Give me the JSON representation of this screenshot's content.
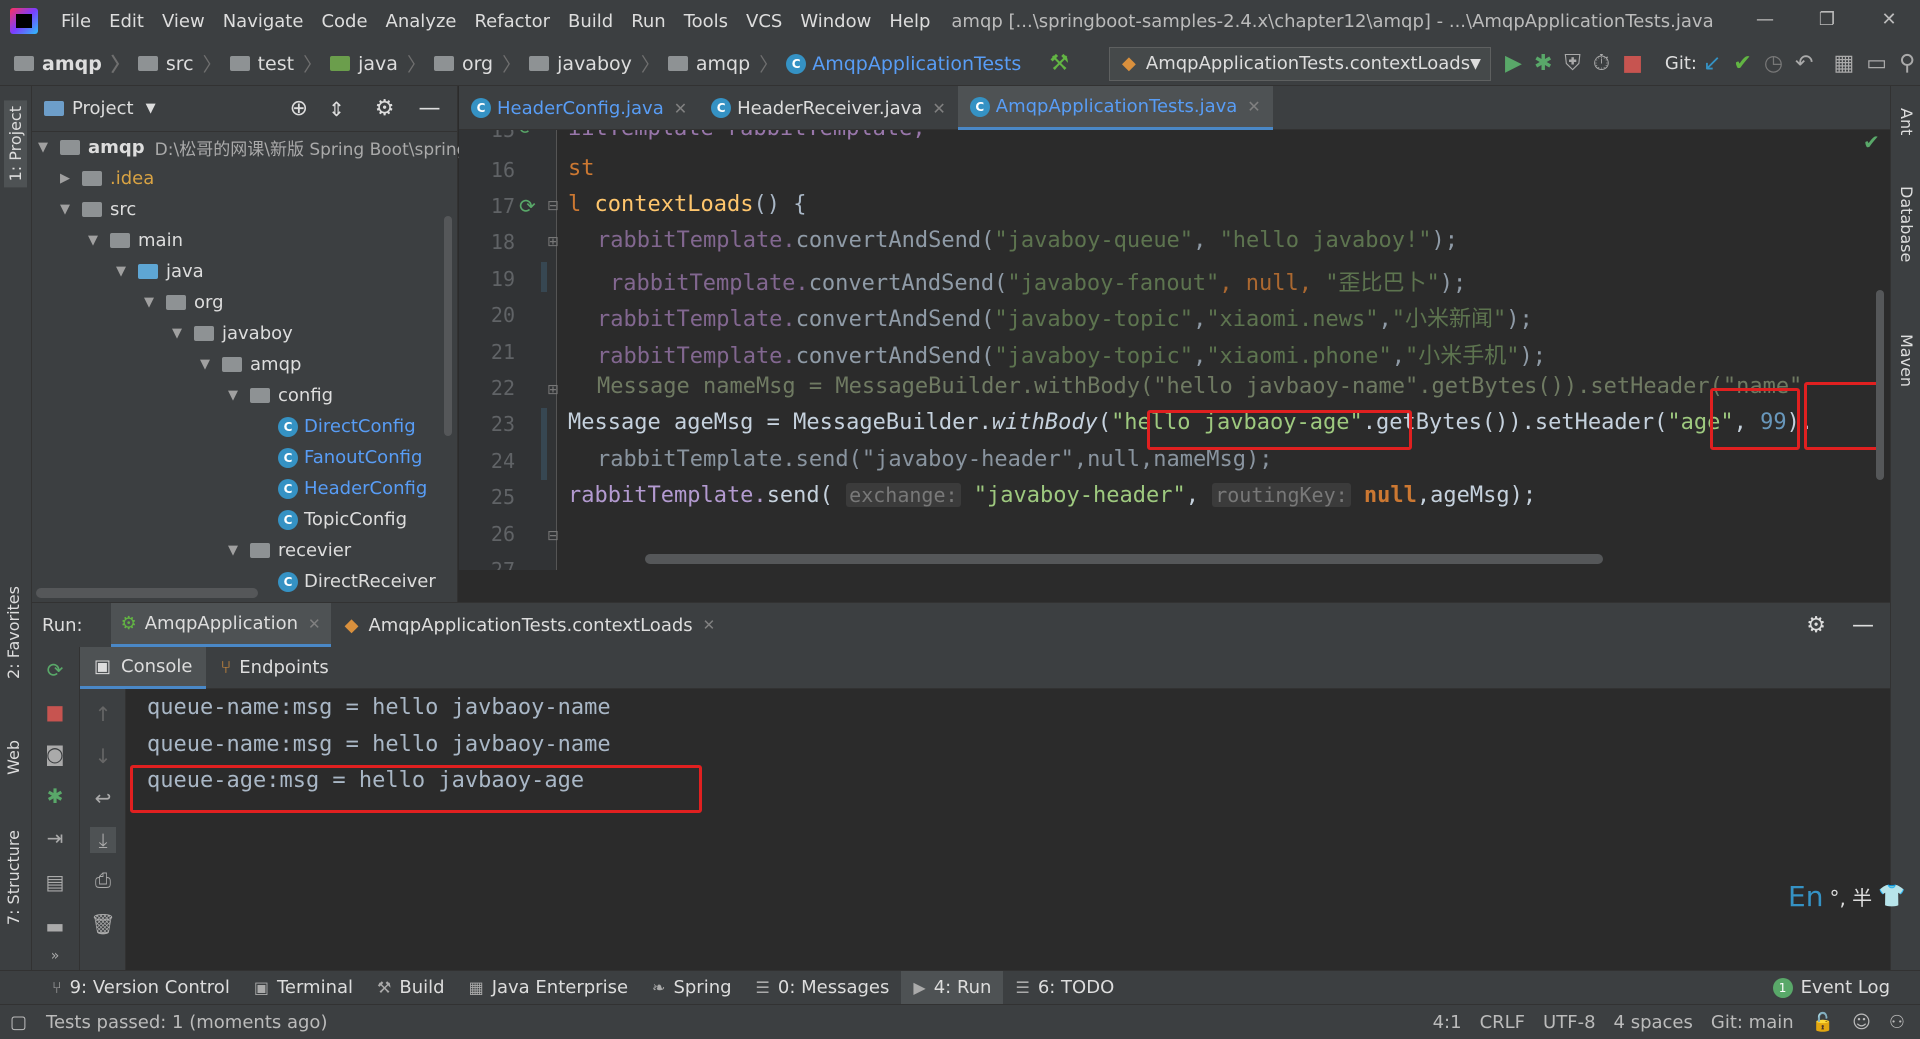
{
  "menu": [
    "File",
    "Edit",
    "View",
    "Navigate",
    "Code",
    "Analyze",
    "Refactor",
    "Build",
    "Run",
    "Tools",
    "VCS",
    "Window",
    "Help"
  ],
  "window_title": "amqp [...\\springboot-samples-2.4.x\\chapter12\\amqp] - ...\\AmqpApplicationTests.java",
  "breadcrumbs": [
    "amqp",
    "src",
    "test",
    "java",
    "org",
    "javaboy",
    "amqp",
    "AmqpApplicationTests"
  ],
  "run_config": "AmqpApplicationTests.contextLoads",
  "git_label": "Git:",
  "project": {
    "title": "Project",
    "root_name": "amqp",
    "root_path": "D:\\松哥的网课\\新版 Spring Boot\\spring",
    "items": [
      ".idea",
      "src",
      "main",
      "java",
      "org",
      "javaboy",
      "amqp",
      "config",
      "DirectConfig",
      "FanoutConfig",
      "HeaderConfig",
      "TopicConfig",
      "recevier",
      "DirectReceiver"
    ]
  },
  "left_tabs": [
    "1: Project",
    "2: Favorites",
    "Web",
    "7: Structure"
  ],
  "right_tabs": [
    "Ant",
    "Database",
    "Maven"
  ],
  "editor_tabs": [
    "HeaderConfig.java",
    "HeaderReceiver.java",
    "AmqpApplicationTests.java"
  ],
  "line_numbers": [
    "15",
    "16",
    "17",
    "18",
    "19",
    "20",
    "21",
    "22",
    "23",
    "24",
    "25",
    "26",
    "27"
  ],
  "code": {
    "l15": "iitTemplate rabbitTemplate;",
    "l16": "st",
    "l17a": "l ",
    "l17b": "contextLoads",
    "l17c": "() {",
    "l18a": "rabbitTemplate.",
    "l18b": "convertAndSend",
    "l18c": "(",
    "l18d": "\"javaboy-queue\"",
    "l18e": ", ",
    "l18f": "\"hello javaboy!\"",
    "l18g": ");",
    "l19a": "rabbitTemplate.",
    "l19b": "convertAndSend",
    "l19c": "(",
    "l19d": "\"javaboy-fanout\"",
    "l19e": ", null, ",
    "l19f": "\"歪比巴卜\"",
    "l19g": ");",
    "l20a": "rabbitTemplate.",
    "l20b": "convertAndSend",
    "l20c": "(",
    "l20d": "\"javaboy-topic\"",
    "l20e": ",",
    "l20f": "\"xiaomi.news\"",
    "l20g": ",",
    "l20h": "\"小米新闻\"",
    "l20i": ");",
    "l21a": "rabbitTemplate.",
    "l21b": "convertAndSend",
    "l21c": "(",
    "l21d": "\"javaboy-topic\"",
    "l21e": ",",
    "l21f": "\"xiaomi.phone\"",
    "l21g": ",",
    "l21h": "\"小米手机\"",
    "l21i": ");",
    "l22": "Message nameMsg = MessageBuilder.withBody(\"hello javbaoy-name\".getBytes()).setHeader(\"name\"",
    "l23a": "Message ageMsg = MessageBuilder.",
    "l23b": "withBody",
    "l23c": "(",
    "l23d": "\"hello javbaoy-age\"",
    "l23e": ".getBytes()).setHeader(",
    "l23f": "\"age\"",
    "l23g": ", ",
    "l23h": "99",
    "l23i": ").",
    "l24": "rabbitTemplate.send(\"javaboy-header\",null,nameMsg);",
    "l25a": "rabbitTemplate.",
    "l25b": "send",
    "l25c": "( ",
    "l25d": "exchange:",
    "l25e": " ",
    "l25f": "\"javaboy-header\"",
    "l25g": ", ",
    "l25h": "routingKey:",
    "l25i": " ",
    "l25j": "null",
    "l25k": ",ageMsg);"
  },
  "run": {
    "label": "Run:",
    "tab1": "AmqpApplication",
    "tab2": "AmqpApplicationTests.contextLoads",
    "console_tab": "Console",
    "endpoints_tab": "Endpoints",
    "lines": [
      "queue-name:msg = hello javbaoy-name",
      "queue-name:msg = hello javbaoy-name",
      "queue-age:msg = hello javbaoy-age"
    ]
  },
  "ime": {
    "lang": "En",
    "rest": "°, 半"
  },
  "bottom_tools": [
    "9: Version Control",
    "Terminal",
    "Build",
    "Java Enterprise",
    "Spring",
    "0: Messages",
    "4: Run",
    "6: TODO"
  ],
  "event_log": "Event Log",
  "event_count": "1",
  "status": {
    "message": "Tests passed: 1 (moments ago)",
    "position": "4:1",
    "line_sep": "CRLF",
    "encoding": "UTF-8",
    "indent": "4 spaces",
    "git": "Git: main"
  },
  "colors": {
    "highlight": "#e02020",
    "accent": "#4a88c7"
  }
}
